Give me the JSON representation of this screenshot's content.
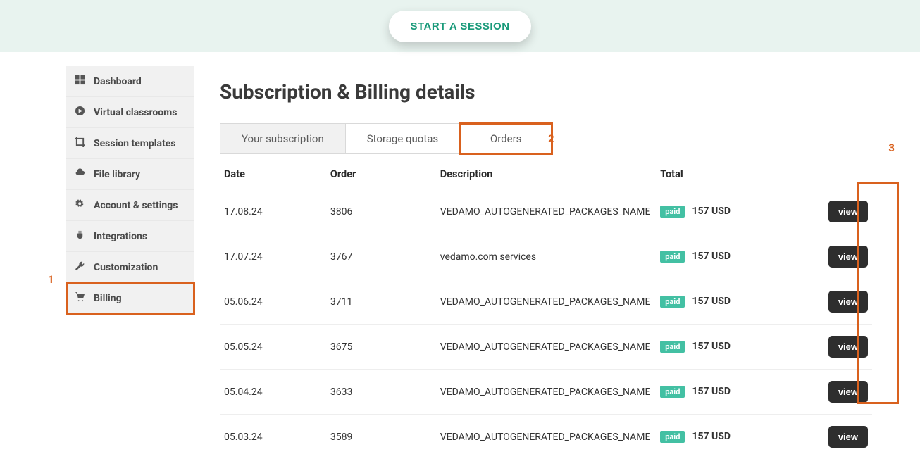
{
  "header": {
    "session_button": "START A SESSION"
  },
  "sidebar": {
    "items": [
      {
        "label": "Dashboard"
      },
      {
        "label": "Virtual classrooms"
      },
      {
        "label": "Session templates"
      },
      {
        "label": "File library"
      },
      {
        "label": "Account & settings"
      },
      {
        "label": "Integrations"
      },
      {
        "label": "Customization"
      },
      {
        "label": "Billing"
      }
    ]
  },
  "page": {
    "title": "Subscription & Billing details"
  },
  "tabs": [
    {
      "label": "Your subscription"
    },
    {
      "label": "Storage quotas"
    },
    {
      "label": "Orders"
    }
  ],
  "table": {
    "headers": {
      "date": "Date",
      "order": "Order",
      "description": "Description",
      "total": "Total"
    },
    "status_label": "paid",
    "view_label": "view",
    "rows": [
      {
        "date": "17.08.24",
        "order": "3806",
        "description": "VEDAMO_AUTOGENERATED_PACKAGES_NAME",
        "total": "157 USD"
      },
      {
        "date": "17.07.24",
        "order": "3767",
        "description": "vedamo.com services",
        "total": "157 USD"
      },
      {
        "date": "05.06.24",
        "order": "3711",
        "description": "VEDAMO_AUTOGENERATED_PACKAGES_NAME",
        "total": "157 USD"
      },
      {
        "date": "05.05.24",
        "order": "3675",
        "description": "VEDAMO_AUTOGENERATED_PACKAGES_NAME",
        "total": "157 USD"
      },
      {
        "date": "05.04.24",
        "order": "3633",
        "description": "VEDAMO_AUTOGENERATED_PACKAGES_NAME",
        "total": "157 USD"
      },
      {
        "date": "05.03.24",
        "order": "3589",
        "description": "VEDAMO_AUTOGENERATED_PACKAGES_NAME",
        "total": "157 USD"
      }
    ]
  },
  "annotations": {
    "a1": "1",
    "a2": "2",
    "a3": "3"
  }
}
